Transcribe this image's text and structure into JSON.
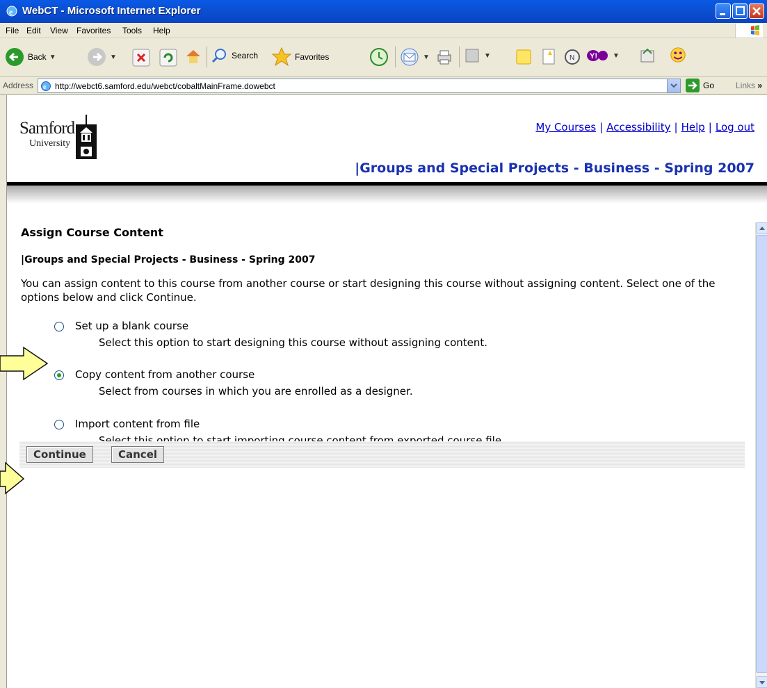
{
  "window": {
    "title": "WebCT - Microsoft Internet Explorer"
  },
  "menu": [
    "File",
    "Edit",
    "View",
    "Favorites",
    "Tools",
    "Help"
  ],
  "toolbar": {
    "back": "Back",
    "search": "Search",
    "favorites": "Favorites"
  },
  "address": {
    "label": "Address",
    "url": "http://webct6.samford.edu/webct/cobaltMainFrame.dowebct",
    "go": "Go",
    "links": "Links"
  },
  "header": {
    "logo_main": "Samford",
    "logo_sub": "University",
    "links": [
      "My Courses",
      "Accessibility",
      "Help",
      "Log out"
    ],
    "course_title": "|Groups and Special Projects - Business - Spring 2007"
  },
  "main": {
    "heading": "Assign Course Content",
    "subheading": "|Groups and Special Projects - Business - Spring 2007",
    "intro": "You can assign content to this course from another course or start designing this course without assigning content. Select one of the options below and click Continue.",
    "options": [
      {
        "label": "Set up a blank course",
        "desc": "Select this option to start designing this course without assigning content.",
        "selected": false
      },
      {
        "label": "Copy content from another course",
        "desc": "Select from courses in which you are enrolled as a designer.",
        "selected": true
      },
      {
        "label": "Import content from file",
        "desc": "Select this option to start importing course content from exported course file.",
        "selected": false
      }
    ],
    "continue": "Continue",
    "cancel": "Cancel"
  },
  "colors": {
    "link": "#0000cc",
    "course_title": "#1a32b0",
    "callout_fill": "#ffff99"
  }
}
